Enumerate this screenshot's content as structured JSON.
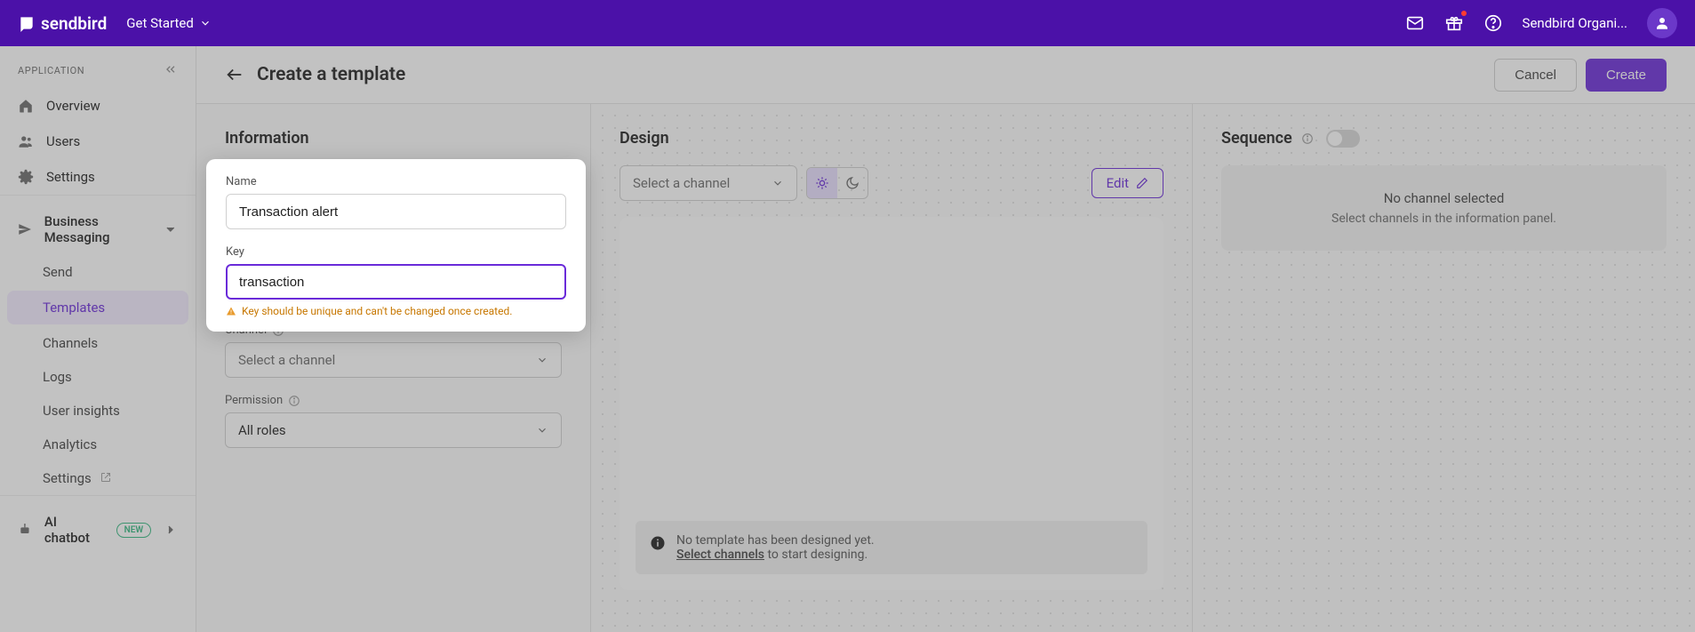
{
  "topnav": {
    "brand": "sendbird",
    "get_started": "Get Started",
    "org": "Sendbird Organi..."
  },
  "sidebar": {
    "section_label": "APPLICATION",
    "items": [
      {
        "label": "Overview"
      },
      {
        "label": "Users"
      },
      {
        "label": "Settings"
      }
    ],
    "business_label": "Business Messaging",
    "business_items": [
      {
        "label": "Send"
      },
      {
        "label": "Templates"
      },
      {
        "label": "Channels"
      },
      {
        "label": "Logs"
      },
      {
        "label": "User insights"
      },
      {
        "label": "Analytics"
      },
      {
        "label": "Settings"
      }
    ],
    "ai_chatbot": "AI chatbot",
    "badge_new": "NEW"
  },
  "header": {
    "title": "Create a template",
    "cancel": "Cancel",
    "create": "Create"
  },
  "info_panel": {
    "title": "Information",
    "name_label": "Name",
    "name_value": "Transaction alert",
    "key_label": "Key",
    "key_value": "transaction",
    "key_warning": "Key should be unique and can't be changed once created.",
    "channel_label": "Channel",
    "channel_placeholder": "Select a channel",
    "permission_label": "Permission",
    "permission_value": "All roles"
  },
  "design_panel": {
    "title": "Design",
    "channel_placeholder": "Select a channel",
    "edit": "Edit",
    "empty_line1": "No template has been designed yet.",
    "empty_link": "Select channels",
    "empty_line2": " to start designing."
  },
  "sequence_panel": {
    "title": "Sequence",
    "empty_title": "No channel selected",
    "empty_sub": "Select channels in the information panel."
  }
}
